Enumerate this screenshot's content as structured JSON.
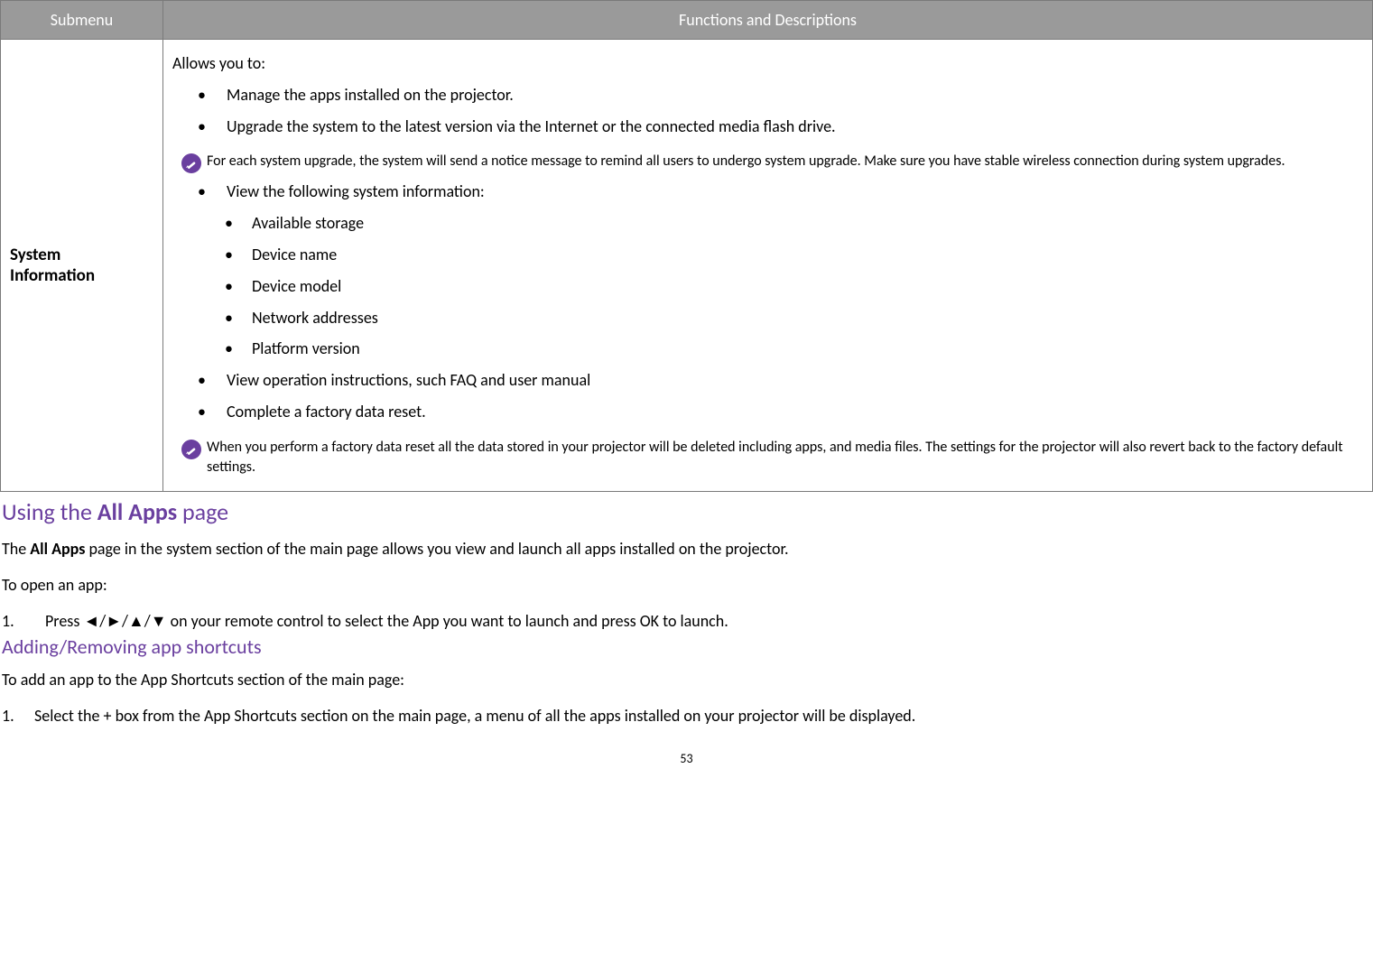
{
  "table": {
    "header_submenu": "Submenu",
    "header_functions": "Functions and Descriptions",
    "row_title_line1": "System",
    "row_title_line2": "Information",
    "intro": "Allows you to:",
    "bullet1": "Manage the apps installed on the projector.",
    "bullet2": "Upgrade the system to the latest version via the Internet or the connected media flash drive.",
    "note1": "For each system upgrade, the system will send a notice message to remind all users to undergo system upgrade. Make sure you have stable wireless connection during system upgrades.",
    "bullet3": "View the following system information:",
    "sub1": "Available storage",
    "sub2": "Device name",
    "sub3": "Device model",
    "sub4": "Network addresses",
    "sub5": "Platform version",
    "bullet4": "View operation instructions, such FAQ and user manual",
    "bullet5": "Complete a factory data reset.",
    "note2": "When you perform a factory data reset all the data stored in your projector will be deleted including apps, and media files. The settings for the projector will also revert back to the factory default settings."
  },
  "section1": {
    "title_pre": "Using the ",
    "title_bold": "All Apps",
    "title_post": " page",
    "p1_pre": "The ",
    "p1_bold": "All Apps",
    "p1_post": " page in the system section of the main page allows you view and launch all apps installed on the projector.",
    "p2": "To open an app:",
    "step_num": "1.",
    "step_pre": "Press ",
    "step_keys": "◄/►/▲/▼",
    "step_mid": " on your remote control to select the App you want to launch and press ",
    "step_ok": "OK",
    "step_post": " to launch."
  },
  "section2": {
    "title": "Adding/Removing app shortcuts",
    "p1": "To add an app to the App Shortcuts section of the main page:",
    "step_num": "1.",
    "step_pre": "Select the ",
    "step_bold": "+",
    "step_post": " box from the App Shortcuts section on the main page, a menu of all the apps installed on your projector will be displayed."
  },
  "page_number": "53"
}
